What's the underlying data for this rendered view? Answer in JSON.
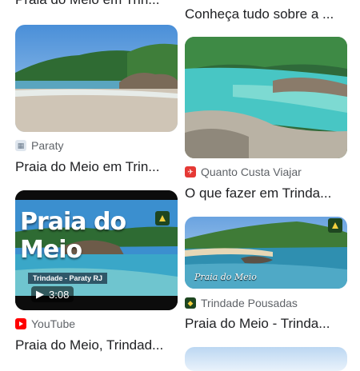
{
  "left": {
    "top_partial_title": "Praia do Meio em Trin...",
    "cards": [
      {
        "source": "Paraty",
        "title": "Praia do Meio em Trin..."
      },
      {
        "source": "YouTube",
        "title": "Praia do Meio, Trindad...",
        "video": {
          "headline": "Praia do Meio",
          "caption": "Trindade - Paraty RJ",
          "duration": "3:08"
        }
      }
    ]
  },
  "right": {
    "top_partial_title": "Conheça tudo sobre a ...",
    "cards": [
      {
        "source": "Quanto Custa Viajar",
        "title": "O que fazer em Trinda..."
      },
      {
        "source": "Trindade Pousadas",
        "title": "Praia do Meio - Trinda...",
        "watermark": "Praia do Meio"
      }
    ]
  },
  "colors": {
    "text": "#202124",
    "source_text": "#5f6368",
    "youtube_red": "#ff0000",
    "quanto_custa_red": "#e53935",
    "pousadas_green": "#1e4620"
  },
  "icons": {
    "paraty": "city-favicon-icon",
    "youtube": "youtube-play-icon",
    "quanto_custa": "plane-favicon-icon",
    "pousadas": "leaf-favicon-icon",
    "video": "play-icon"
  }
}
